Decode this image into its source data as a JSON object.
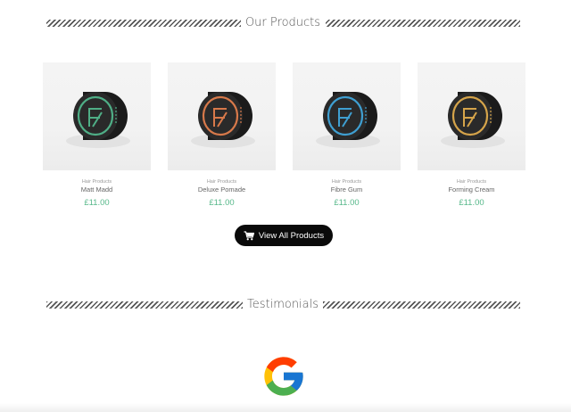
{
  "products_section": {
    "title": "Our Products",
    "items": [
      {
        "category": "Hair Products",
        "name": "Matt Madd",
        "price": "£11.00",
        "accent": "#4fae86"
      },
      {
        "category": "Hair Products",
        "name": "Deluxe Pomade",
        "price": "£11.00",
        "accent": "#d7794a"
      },
      {
        "category": "Hair Products",
        "name": "Fibre Gum",
        "price": "£11.00",
        "accent": "#3f9fd1"
      },
      {
        "category": "Hair Products",
        "name": "Forming Cream",
        "price": "£11.00",
        "accent": "#d5a44a"
      }
    ],
    "view_all_label": "View All Products",
    "view_all_icon": "cart-icon"
  },
  "testimonials_section": {
    "title": "Testimonials",
    "logo": "google-logo"
  },
  "colors": {
    "price": "#57b88a",
    "button_bg": "#0a0a0a",
    "heading": "#555555"
  }
}
